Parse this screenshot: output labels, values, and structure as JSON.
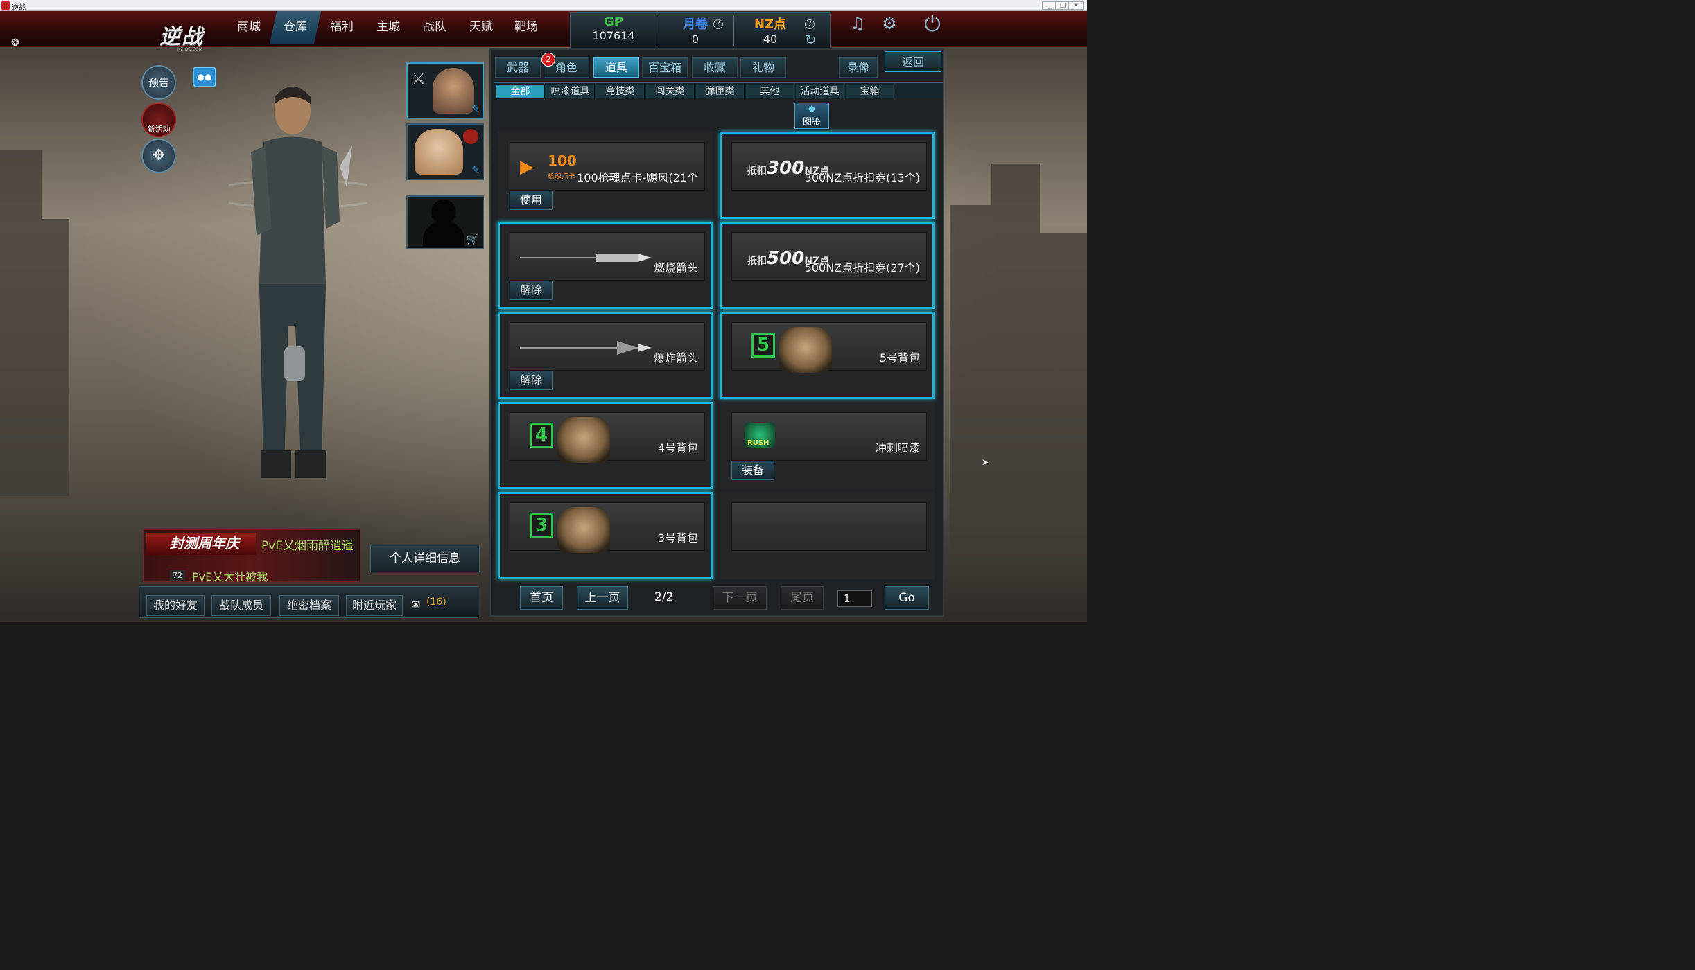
{
  "window": {
    "title": "逆战",
    "min": "▁",
    "max": "□",
    "close": "×"
  },
  "logo": {
    "title": "逆战",
    "subtitle": "NZ.QQ.COM"
  },
  "nav": [
    "商城",
    "仓库",
    "福利",
    "主城",
    "战队",
    "天赋",
    "靶场"
  ],
  "stats": {
    "gp": {
      "label": "GP",
      "value": "107614",
      "color": "#3ec04a"
    },
    "ticket": {
      "label": "月卷",
      "value": "0",
      "color": "#3d7fe0"
    },
    "nz": {
      "label": "NZ点",
      "value": "40",
      "color": "#f0a020"
    }
  },
  "left_buttons": {
    "preview": "预告",
    "new_event": "新活动"
  },
  "tabs": {
    "main": [
      "武器",
      "角色",
      "道具",
      "百宝箱",
      "收藏",
      "礼物"
    ],
    "badge": "2",
    "record": "录像",
    "back": "返回",
    "sub": [
      "全部",
      "喷漆道具",
      "竞技类",
      "闯关类",
      "弹匣类",
      "其他",
      "活动道具",
      "宝箱"
    ],
    "catalog": "图鉴"
  },
  "items": [
    {
      "name": "100枪魂点卡-飓风(21个",
      "action": "使用",
      "art_label": "100",
      "art_sub": "枪魂点卡"
    },
    {
      "name": "300NZ点折扣券(13个)",
      "action": "",
      "art_prefix": "抵扣",
      "art_value": "300",
      "art_unit": "NZ点"
    },
    {
      "name": "燃烧箭头",
      "action": "解除"
    },
    {
      "name": "500NZ点折扣券(27个)",
      "action": "",
      "art_prefix": "抵扣",
      "art_value": "500",
      "art_unit": "NZ点"
    },
    {
      "name": "爆炸箭头",
      "action": "解除"
    },
    {
      "name": "5号背包",
      "action": "",
      "art_num": "5"
    },
    {
      "name": "4号背包",
      "action": "",
      "art_num": "4"
    },
    {
      "name": "冲刺喷漆",
      "action": "装备",
      "art_label": "RUSH"
    },
    {
      "name": "3号背包",
      "action": "",
      "art_num": "3"
    },
    {
      "name": "",
      "action": ""
    }
  ],
  "pager": {
    "first": "首页",
    "prev": "上一页",
    "page": "2/2",
    "next": "下一页",
    "last": "尾页",
    "input": "1",
    "go": "Go"
  },
  "events": {
    "banner": "封测周年庆",
    "line1": "PvE乂烟雨醉逍遥",
    "level": "72",
    "line2": "PvE乂大壮被我"
  },
  "detail_btn": "个人详细信息",
  "bottom": {
    "friends": "我的好友",
    "team": "战队成员",
    "archive": "绝密档案",
    "nearby": "附近玩家",
    "mail": "(16)"
  }
}
